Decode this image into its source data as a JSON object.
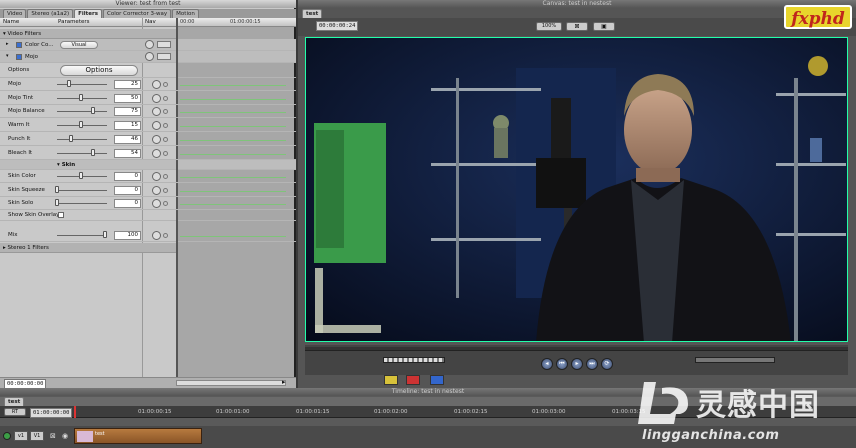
{
  "viewer": {
    "title": "Viewer: test from test",
    "tabs": [
      "Video",
      "Stereo (a1a2)",
      "Filters",
      "Color Corrector 3-way",
      "Motion"
    ],
    "active_tab": "Filters",
    "columns": {
      "name": "Name",
      "parameters": "Parameters",
      "nav": "Nav"
    },
    "ruler_timecodes": [
      "00:00",
      "01:00:00:15"
    ],
    "sections": {
      "video_filters": "Video Filters",
      "color_corrector": "Color Co...",
      "mojo": "Mojo",
      "skin": "Skin",
      "stereo_filters": "Stereo 1 Filters"
    },
    "buttons": {
      "visual": "Visual",
      "options": "Options"
    },
    "params": [
      {
        "label": "Options",
        "kind": "button"
      },
      {
        "label": "Mojo",
        "value": "25",
        "pct": 0.25
      },
      {
        "label": "Mojo Tint",
        "value": "50",
        "pct": 0.5
      },
      {
        "label": "Mojo Balance",
        "value": "75",
        "pct": 0.75
      },
      {
        "label": "Warm It",
        "value": "15",
        "pct": 0.5
      },
      {
        "label": "Punch It",
        "value": "46",
        "pct": 0.3
      },
      {
        "label": "Bleach It",
        "value": "54",
        "pct": 0.75
      }
    ],
    "skin_params": [
      {
        "label": "Skin Color",
        "value": "0",
        "pct": 0.5
      },
      {
        "label": "Skin Squeeze",
        "value": "0",
        "pct": 0.0
      },
      {
        "label": "Skin Solo",
        "value": "0",
        "pct": 0.0
      }
    ],
    "show_skin_overlay": "Show Skin Overlay",
    "mix": {
      "label": "Mix",
      "value": "100",
      "pct": 1.0
    },
    "footer_timecode": "00:00:00:00"
  },
  "canvas": {
    "title": "Canvas: test in nestest",
    "tab": "test",
    "timecode": "00:00:00:24",
    "zoom": "100%"
  },
  "timeline": {
    "title": "Timeline: test in nestest",
    "tab": "test",
    "current_timecode": "01:00:00:00",
    "ruler_ticks": [
      "01:00:00:15",
      "01:00:01:00",
      "01:00:01:15",
      "01:00:02:00",
      "01:00:02:15",
      "01:00:03:00",
      "01:00:03:15"
    ],
    "tracks": {
      "v1": "v1",
      "v1_target": "V1"
    },
    "clip_name": "test",
    "rt_label": "RT"
  },
  "watermarks": {
    "fxphd": "fxphd",
    "lg_cn": "灵感中国",
    "lg_url": "lingganchina.com"
  },
  "colors": {
    "keyframe_lane": "#7fc47a",
    "canvas_border": "#22ffaa",
    "clip": "#a56a35",
    "fx_logo_bg": "#e8d52c",
    "fx_logo_text": "#c0261c"
  }
}
